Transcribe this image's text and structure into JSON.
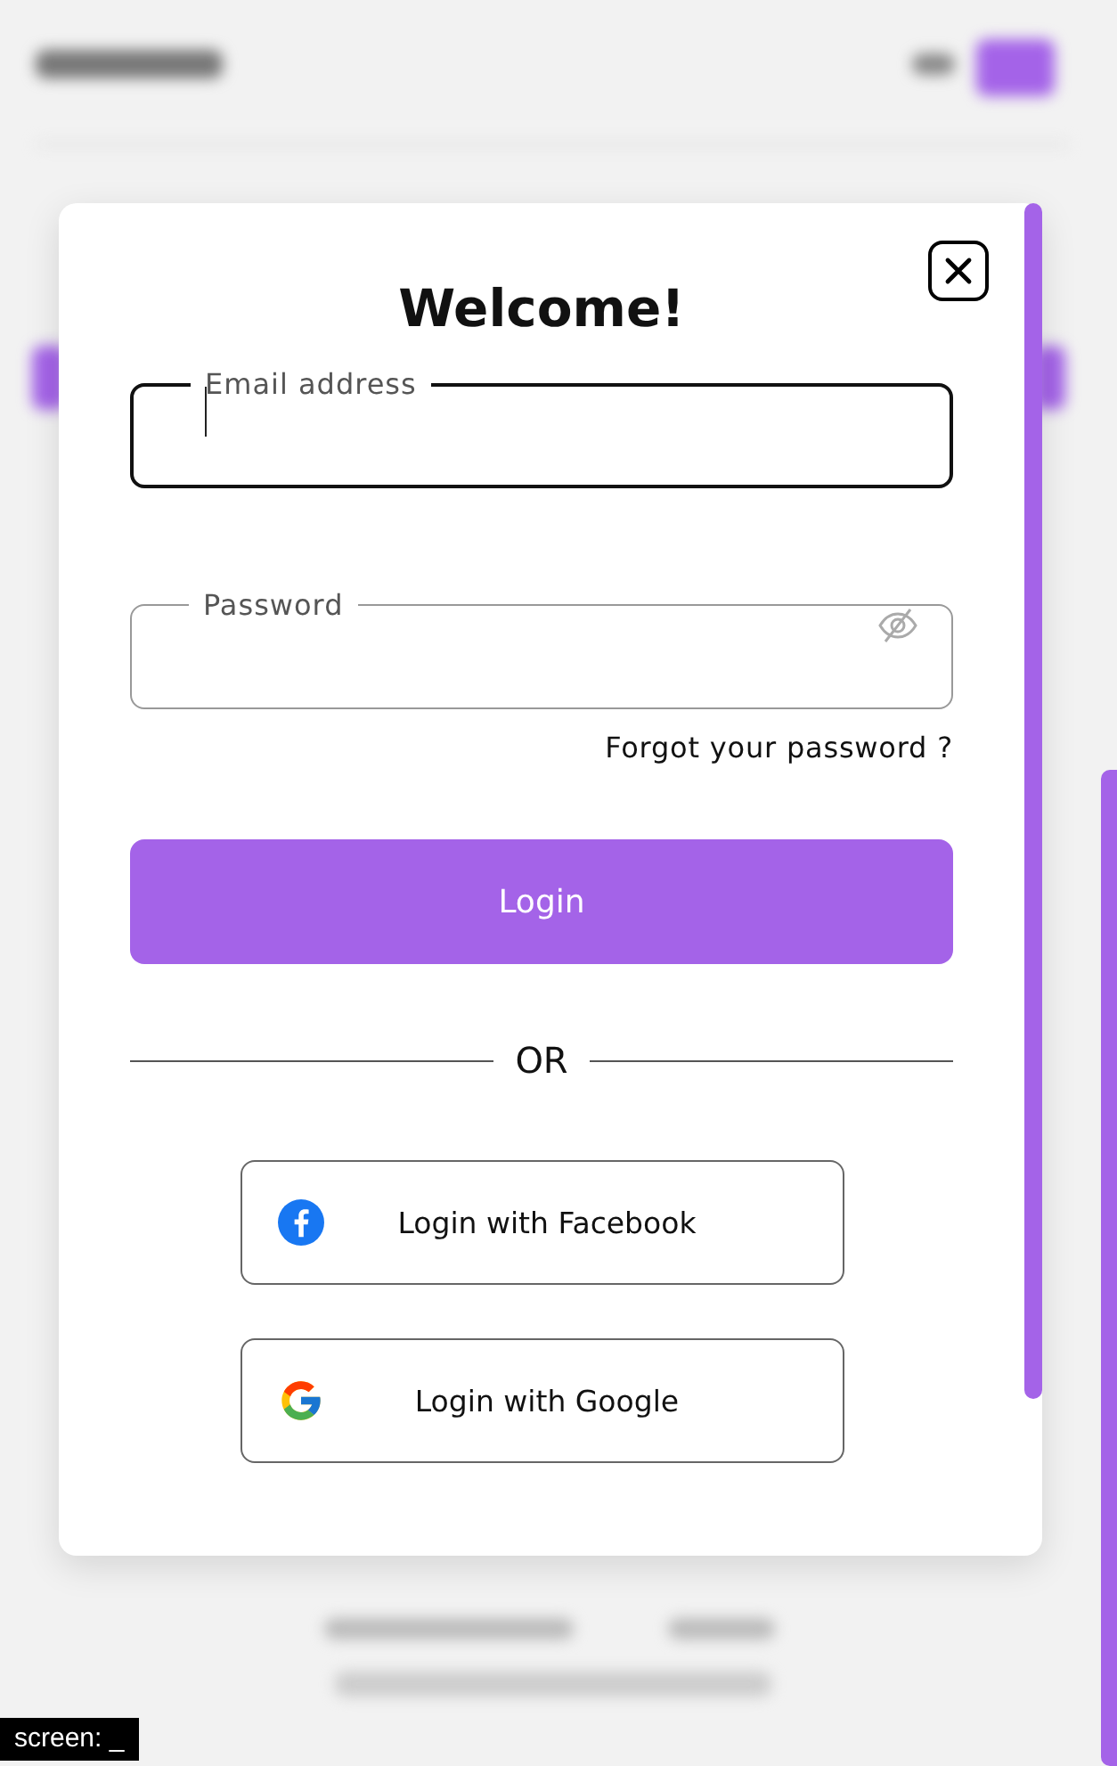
{
  "modal": {
    "title": "Welcome!",
    "fields": [
      {
        "kind": "email",
        "label": "Email address",
        "focused": true
      },
      {
        "kind": "password",
        "label": "Password",
        "focused": false
      }
    ],
    "forgot_link": "Forgot your password ?",
    "login_button": "Login",
    "divider": "OR",
    "social_buttons": [
      {
        "kind": "facebook",
        "label": "Login with Facebook"
      },
      {
        "kind": "google",
        "label": "Login with Google"
      }
    ]
  },
  "screen_label": "screen: _"
}
